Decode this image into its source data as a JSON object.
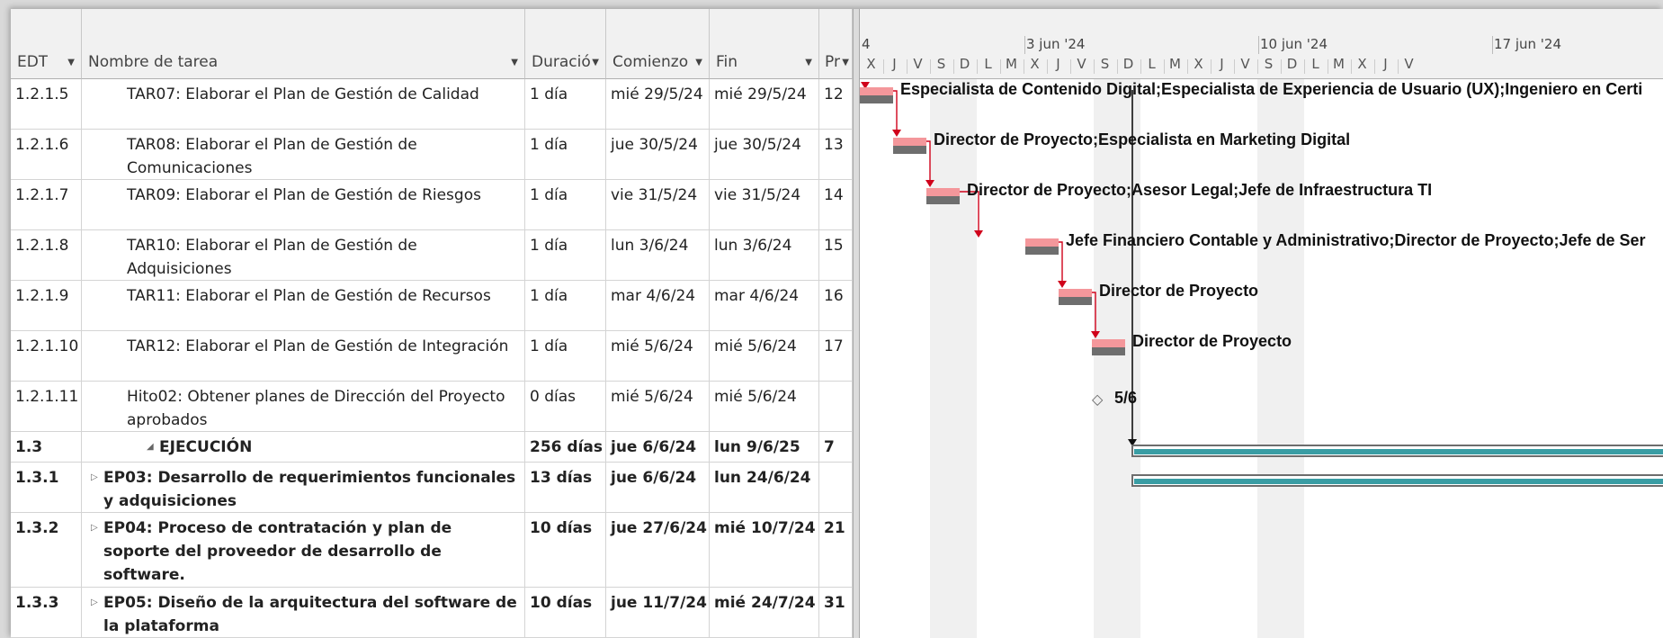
{
  "columns": [
    {
      "key": "edt",
      "label": "EDT",
      "has_arrow": true
    },
    {
      "key": "name",
      "label": "Nombre de tarea",
      "has_arrow": true
    },
    {
      "key": "dur",
      "label": "Duració",
      "has_arrow": true
    },
    {
      "key": "start",
      "label": "Comienzo",
      "has_arrow": true
    },
    {
      "key": "end",
      "label": "Fin",
      "has_arrow": true
    },
    {
      "key": "pred",
      "label": "Pr",
      "has_arrow": true
    }
  ],
  "rows": [
    {
      "edt": "1.2.1.5",
      "name": "TAR07: Elaborar el Plan de Gestión de Calidad",
      "dur": "1 día",
      "start": "mié 29/5/24",
      "end": "mié 29/5/24",
      "pred": "12",
      "summary": false,
      "indent": 2
    },
    {
      "edt": "1.2.1.6",
      "name": "TAR08: Elaborar el Plan de Gestión de Comunicaciones",
      "dur": "1 día",
      "start": "jue 30/5/24",
      "end": "jue 30/5/24",
      "pred": "13",
      "summary": false,
      "indent": 2
    },
    {
      "edt": "1.2.1.7",
      "name": "TAR09: Elaborar el Plan de Gestión de Riesgos",
      "dur": "1 día",
      "start": "vie 31/5/24",
      "end": "vie 31/5/24",
      "pred": "14",
      "summary": false,
      "indent": 2
    },
    {
      "edt": "1.2.1.8",
      "name": "TAR10: Elaborar el Plan de Gestión de Adquisiciones",
      "dur": "1 día",
      "start": "lun 3/6/24",
      "end": "lun 3/6/24",
      "pred": "15",
      "summary": false,
      "indent": 2
    },
    {
      "edt": "1.2.1.9",
      "name": "TAR11: Elaborar el Plan de Gestión de Recursos",
      "dur": "1 día",
      "start": "mar 4/6/24",
      "end": "mar 4/6/24",
      "pred": "16",
      "summary": false,
      "indent": 2
    },
    {
      "edt": "1.2.1.10",
      "name": "TAR12: Elaborar el Plan de Gestión de Integración",
      "dur": "1 día",
      "start": "mié 5/6/24",
      "end": "mié 5/6/24",
      "pred": "17",
      "summary": false,
      "indent": 2
    },
    {
      "edt": "1.2.1.11",
      "name": "Hito02: Obtener planes de Dirección del Proyecto aprobados",
      "dur": "0 días",
      "start": "mié 5/6/24",
      "end": "mié 5/6/24",
      "pred": "",
      "summary": false,
      "indent": 2
    },
    {
      "edt": "1.3",
      "name": "EJECUCIÓN",
      "dur": "256 días",
      "start": "jue 6/6/24",
      "end": "lun 9/6/25",
      "pred": "7",
      "summary": true,
      "indent": 0,
      "toggle": "◢"
    },
    {
      "edt": "1.3.1",
      "name": "EP03: Desarrollo de requerimientos funcionales y adquisiciones",
      "dur": "13 días",
      "start": "jue 6/6/24",
      "end": "lun 24/6/24",
      "pred": "",
      "summary": true,
      "indent": 1,
      "toggle": "▷"
    },
    {
      "edt": "1.3.2",
      "name": "EP04: Proceso de contratación y plan de soporte del proveedor de desarrollo de software.",
      "dur": "10 días",
      "start": "jue 27/6/24",
      "end": "mié 10/7/24",
      "pred": "21",
      "summary": true,
      "indent": 1,
      "toggle": "▷"
    },
    {
      "edt": "1.3.3",
      "name": "EP05: Diseño de la arquitectura del software de la plataforma",
      "dur": "10 días",
      "start": "jue 11/7/24",
      "end": "mié 24/7/24",
      "pred": "31",
      "summary": true,
      "indent": 1,
      "toggle": "▷"
    }
  ],
  "timescale": {
    "weeks": [
      {
        "label": "4"
      },
      {
        "label": "3 jun '24"
      },
      {
        "label": "10 jun '24"
      },
      {
        "label": "17 jun '24"
      }
    ],
    "days": [
      "X",
      "J",
      "V",
      "S",
      "D",
      "L",
      "M",
      "X",
      "J",
      "V",
      "S",
      "D",
      "L",
      "M",
      "X",
      "J",
      "V",
      "S",
      "D",
      "L",
      "M",
      "X",
      "J",
      "V"
    ]
  },
  "gantt_labels": [
    "Especialista de Contenido Digital;Especialista de Experiencia de Usuario (UX);Ingeniero en Certi",
    "Director de Proyecto;Especialista en Marketing Digital",
    "Director de Proyecto;Asesor Legal;Jefe de Infraestructura TI",
    "Jefe Financiero Contable y Administrativo;Director de Proyecto;Jefe de Ser",
    "Director de Proyecto",
    "Director de Proyecto"
  ],
  "milestone_label": "5/6",
  "colors": {
    "task_bar_top": "#f4979b",
    "task_bar_bottom": "#6e6e6e",
    "summary_fill": "#3a9da4",
    "link_arrow": "#d0021b"
  }
}
